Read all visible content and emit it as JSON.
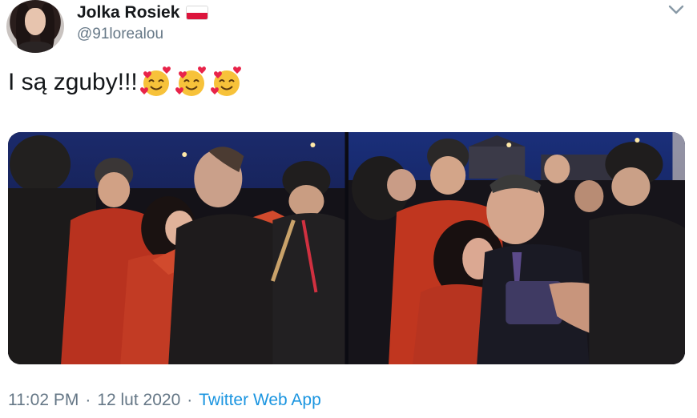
{
  "author": {
    "name": "Jolka Rosiek",
    "handle": "@91lorealou",
    "flag_icon": "poland-flag-icon"
  },
  "tweet": {
    "text": "I są zguby!!!",
    "emojis": [
      "smiling-face-with-hearts",
      "smiling-face-with-hearts",
      "smiling-face-with-hearts"
    ]
  },
  "media": {
    "count": 2,
    "photos": [
      "photo-left",
      "photo-right"
    ]
  },
  "meta": {
    "time": "11:02 PM",
    "separator": "·",
    "date": "12 lut 2020",
    "source": "Twitter Web App"
  },
  "colors": {
    "text": "#14171a",
    "secondary": "#657786",
    "link": "#1b95e0",
    "emoji_face": "#f7c23a",
    "emoji_heart": "#e8244a"
  }
}
